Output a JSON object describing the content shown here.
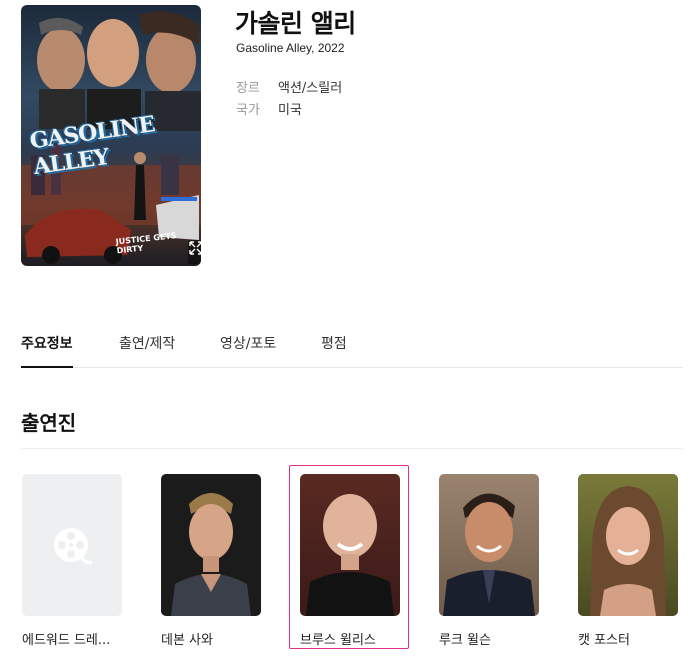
{
  "movie": {
    "title": "가솔린 앨리",
    "subtitle": "Gasoline Alley, 2022",
    "poster": {
      "title_text": "GASOLINE ALLEY",
      "tagline": "JUSTICE GETS DIRTY"
    },
    "meta": [
      {
        "key": "장르",
        "value": "액션/스릴러"
      },
      {
        "key": "국가",
        "value": "미국"
      }
    ]
  },
  "tabs": [
    {
      "label": "주요정보",
      "active": true
    },
    {
      "label": "출연/제작",
      "active": false
    },
    {
      "label": "영상/포토",
      "active": false
    },
    {
      "label": "평점",
      "active": false
    }
  ],
  "cast_section": {
    "title": "출연진",
    "members": [
      {
        "name": "에드워드 드레...",
        "has_photo": false
      },
      {
        "name": "데본 사와",
        "has_photo": true
      },
      {
        "name": "브루스 윌리스",
        "has_photo": true,
        "highlighted": true
      },
      {
        "name": "루크 윌슨",
        "has_photo": true
      },
      {
        "name": "캣 포스터",
        "has_photo": true
      }
    ]
  },
  "colors": {
    "highlight_border": "#e0308a",
    "tab_active": "#111111",
    "placeholder_bg": "#eeeff1"
  },
  "icons": {
    "expand": "expand-icon",
    "film_reel": "film-reel-icon"
  }
}
